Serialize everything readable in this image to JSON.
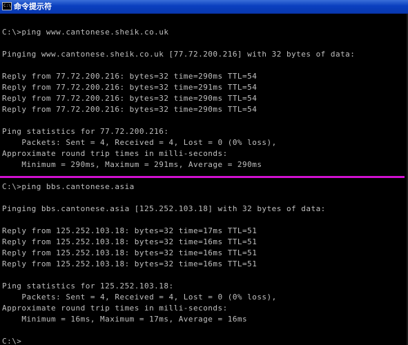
{
  "window": {
    "title": "命令提示符",
    "icon": "cmd-icon",
    "icon_glyph": "C:\\"
  },
  "divider_color": "#d010d0",
  "console": {
    "lines": [
      "C:\\>ping www.cantonese.sheik.co.uk",
      "",
      "Pinging www.cantonese.sheik.co.uk [77.72.200.216] with 32 bytes of data:",
      "",
      "Reply from 77.72.200.216: bytes=32 time=290ms TTL=54",
      "Reply from 77.72.200.216: bytes=32 time=291ms TTL=54",
      "Reply from 77.72.200.216: bytes=32 time=290ms TTL=54",
      "Reply from 77.72.200.216: bytes=32 time=290ms TTL=54",
      "",
      "Ping statistics for 77.72.200.216:",
      "    Packets: Sent = 4, Received = 4, Lost = 0 (0% loss),",
      "Approximate round trip times in milli-seconds:",
      "    Minimum = 290ms, Maximum = 291ms, Average = 290ms",
      "",
      "C:\\>ping bbs.cantonese.asia",
      "",
      "Pinging bbs.cantonese.asia [125.252.103.18] with 32 bytes of data:",
      "",
      "Reply from 125.252.103.18: bytes=32 time=17ms TTL=51",
      "Reply from 125.252.103.18: bytes=32 time=16ms TTL=51",
      "Reply from 125.252.103.18: bytes=32 time=16ms TTL=51",
      "Reply from 125.252.103.18: bytes=32 time=16ms TTL=51",
      "",
      "Ping statistics for 125.252.103.18:",
      "    Packets: Sent = 4, Received = 4, Lost = 0 (0% loss),",
      "Approximate round trip times in milli-seconds:",
      "    Minimum = 16ms, Maximum = 17ms, Average = 16ms",
      "",
      "C:\\>"
    ]
  }
}
